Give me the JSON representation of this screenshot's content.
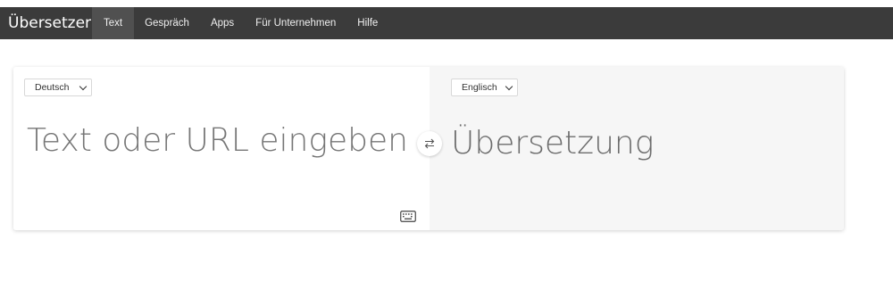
{
  "navbar": {
    "brand": "Übersetzer",
    "items": [
      {
        "label": "Text",
        "active": true
      },
      {
        "label": "Gespräch",
        "active": false
      },
      {
        "label": "Apps",
        "active": false
      },
      {
        "label": "Für Unternehmen",
        "active": false
      },
      {
        "label": "Hilfe",
        "active": false
      }
    ]
  },
  "source": {
    "language": "Deutsch",
    "placeholder": "Text oder URL eingeben"
  },
  "target": {
    "language": "Englisch",
    "placeholder": "Übersetzung"
  },
  "icons": {
    "swap": "swap-arrows-icon",
    "keyboard": "keyboard-icon"
  },
  "colors": {
    "navbar_bg": "#3b3b3b",
    "navbar_active_bg": "#505050",
    "target_pane_bg": "#f6f6f6"
  }
}
